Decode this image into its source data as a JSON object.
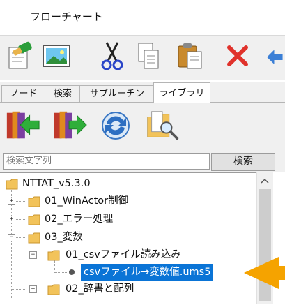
{
  "window": {
    "title": "フローチャート"
  },
  "toolbar": {
    "buttons": [
      {
        "icon": "properties-icon"
      },
      {
        "icon": "image-icon"
      },
      {
        "icon": "scissors-icon"
      },
      {
        "icon": "copy-icon"
      },
      {
        "icon": "paste-icon"
      },
      {
        "icon": "delete-icon"
      },
      {
        "icon": "undo-icon"
      }
    ]
  },
  "tabs": [
    {
      "label": "ノード"
    },
    {
      "label": "検索"
    },
    {
      "label": "サブルーチン"
    },
    {
      "label": "ライブラリ",
      "active": true
    }
  ],
  "library_toolbar": {
    "buttons": [
      {
        "icon": "import-icon"
      },
      {
        "icon": "export-icon"
      },
      {
        "icon": "refresh-icon"
      },
      {
        "icon": "folder-search-icon"
      }
    ]
  },
  "search": {
    "placeholder": "検索文字列",
    "button_label": "検索"
  },
  "tree": {
    "root": "NTTAT_v5.3.0",
    "items": [
      {
        "label": "01_WinActor制御",
        "expander": "+"
      },
      {
        "label": "02_エラー処理",
        "expander": "+"
      },
      {
        "label": "03_変数",
        "expander": "−"
      },
      {
        "label": "01_csvファイル読み込み",
        "expander": "−"
      },
      {
        "label": "csvファイル→変数値.ums5",
        "selected": true
      },
      {
        "label": "02_辞書と配列",
        "expander": "+"
      }
    ]
  },
  "colors": {
    "selection": "#0a74d6",
    "callout_arrow": "#f5a300"
  }
}
